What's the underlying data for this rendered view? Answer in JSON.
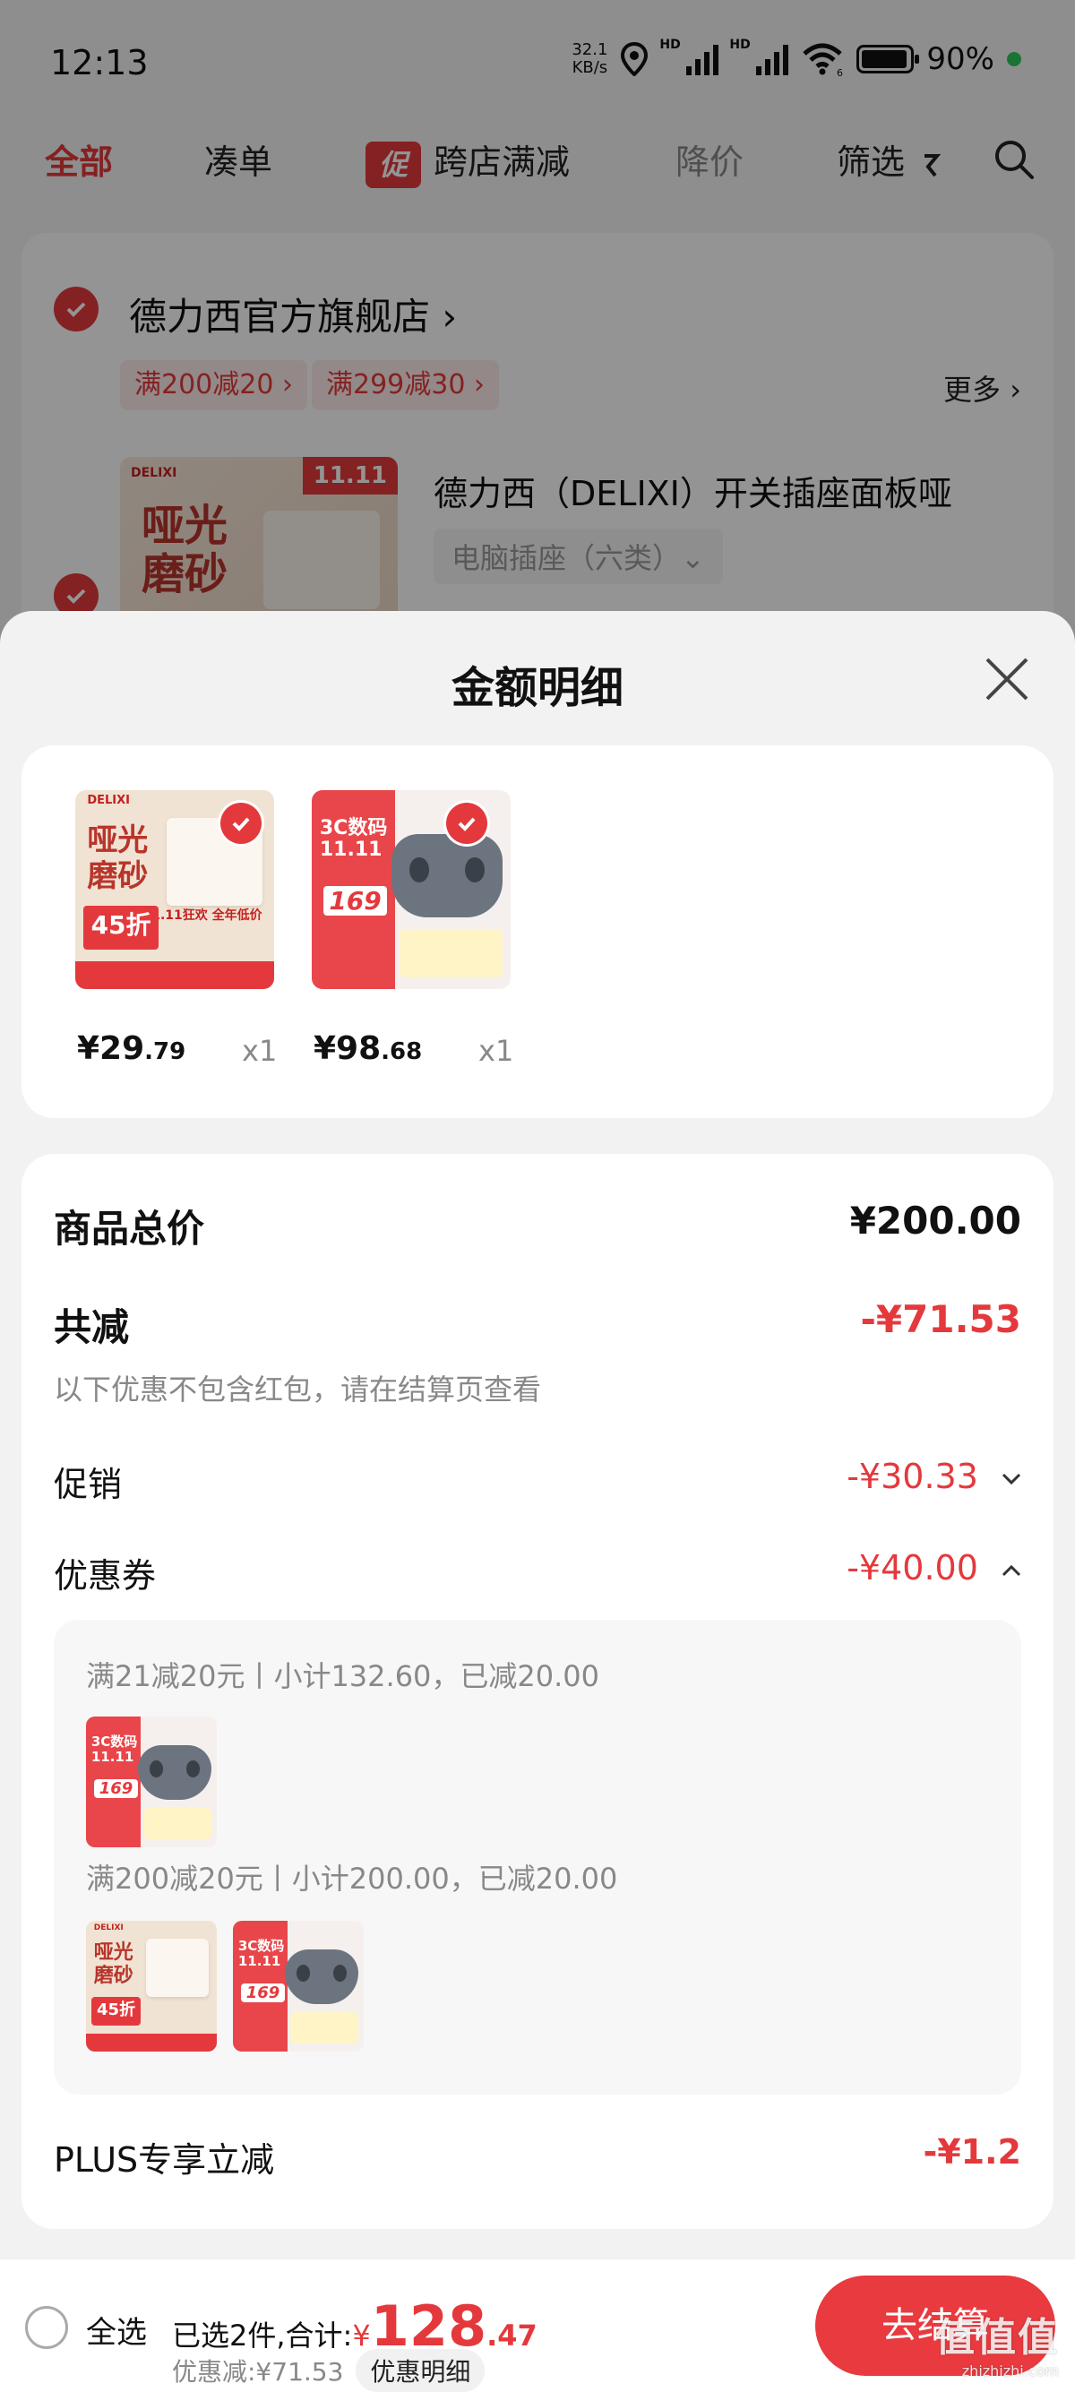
{
  "status": {
    "time": "12:13",
    "net_speed_value": "32.1",
    "net_speed_unit": "KB/s",
    "hd1": "HD",
    "hd2": "HD",
    "wifi_sub": "6",
    "battery": "90%"
  },
  "tabs": {
    "all": "全部",
    "combine": "凑单",
    "promo_badge": "促",
    "cross_store": "跨店满减",
    "price_drop": "降价",
    "filter": "筛选"
  },
  "store": {
    "name": "德力西官方旗舰店",
    "name_arrow": "›",
    "coupons": [
      "满200减20 ›",
      "满299减30 ›"
    ],
    "more": "更多 ›",
    "product_title": "德力西（DELIXI）开关插座面板哑",
    "product_sku": "电脑插座（六类）⌄",
    "product_art_text": "哑光磨砂",
    "product_badge": "11.11",
    "product_brand": "DELIXI"
  },
  "sheet": {
    "title": "金额明细",
    "items": [
      {
        "price_int": "¥29",
        "price_dec": ".79",
        "qty": "x1"
      },
      {
        "price_int": "¥98",
        "price_dec": ".68",
        "qty": "x1"
      }
    ],
    "art": {
      "delixi_brand": "DELIXI",
      "delixi_text_1": "哑光",
      "delixi_text_2": "磨砂",
      "delixi_off": "45折",
      "delixi_sale": "11.11狂欢 全年低价",
      "pad_text_1": "3C数码",
      "pad_text_2": "11.11",
      "pad_price": "169"
    },
    "total_label": "商品总价",
    "total_value": "¥200.00",
    "reduce_label": "共减",
    "reduce_value": "-¥71.53",
    "reduce_note": "以下优惠不包含红包，请在结算页查看",
    "promo_label": "促销",
    "promo_value": "-¥30.33",
    "coupon_label": "优惠券",
    "coupon_value": "-¥40.00",
    "coupon_rules": [
      "满21减20元丨小计132.60，已减20.00",
      "满200减20元丨小计200.00，已减20.00"
    ],
    "plus_label": "PLUS专享立减",
    "plus_value": "-¥1.2"
  },
  "bottom": {
    "select_all": "全选",
    "summary_prefix": "已选2件,合计:",
    "currency": "¥",
    "amount_int": "128",
    "amount_dec": ".47",
    "discount_text": "优惠减:¥71.53",
    "discount_detail_btn": "优惠明细",
    "checkout": "去结算",
    "watermark": "值值值",
    "watermark_sub": "zhizhizhi.com"
  },
  "colors": {
    "accent": "#e4393c",
    "overlay": "rgba(0,0,0,0.42)"
  }
}
